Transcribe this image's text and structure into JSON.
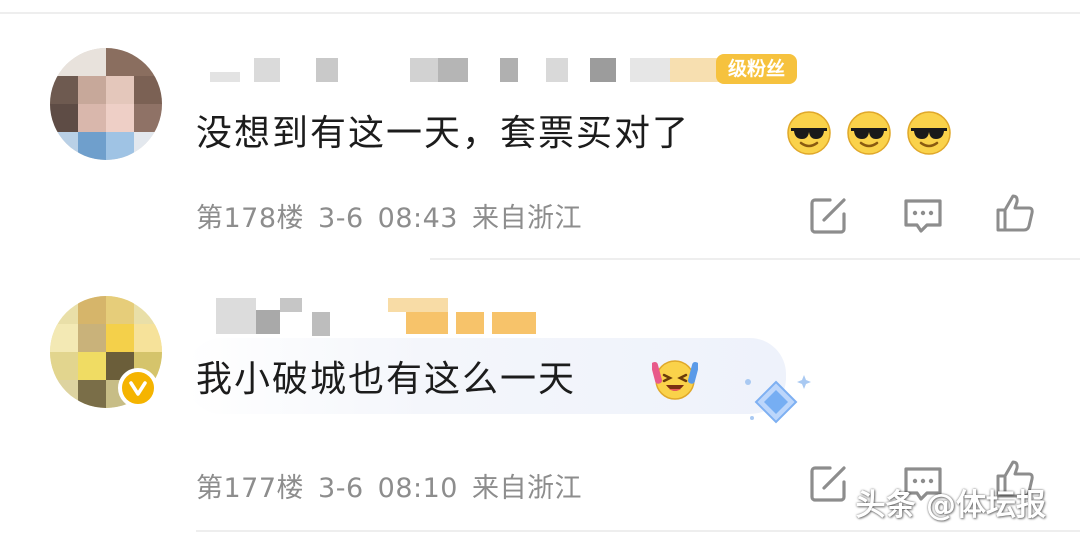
{
  "comments": [
    {
      "badge": "级粉丝",
      "text": "没想到有这一天，套票买对了",
      "floor": "第178楼",
      "date": "3-6",
      "time": "08:43",
      "location": "来自浙江",
      "emojis": [
        "sunglasses-face",
        "sunglasses-face",
        "sunglasses-face"
      ]
    },
    {
      "text": "我小破城也有这么一天",
      "floor": "第177楼",
      "date": "3-6",
      "time": "08:10",
      "location": "来自浙江",
      "emojis": [
        "laughing-cheer-face"
      ],
      "verified": true
    }
  ],
  "watermark": "头条 @体坛报",
  "colors": {
    "badge": "#f6c23e",
    "meta_text": "#8d8d8d",
    "icon_stroke": "#8d8d8d",
    "divider": "#eeeeee"
  }
}
